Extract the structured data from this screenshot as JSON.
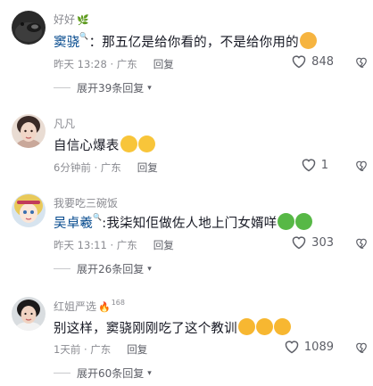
{
  "comments": [
    {
      "username": "好好",
      "badge": "🌿",
      "mention": "窦骁",
      "text": "：那五亿是给你看的，不是给你用的",
      "emoji": "🥴",
      "time": "昨天 13:28",
      "location": "广东",
      "reply": "回复",
      "likes": "848",
      "expand": "展开39条回复"
    },
    {
      "username": "凡凡",
      "text": "自信心爆表",
      "emoji": "😂😂",
      "time": "6分钟前",
      "location": "广东",
      "reply": "回复",
      "likes": "1"
    },
    {
      "username": "我要吃三碗饭",
      "mention": "吴卓羲",
      "text": ":我柒知佢做佐人地上门女婿咩",
      "emoji": "🤮🤮",
      "time": "昨天 13:11",
      "location": "广东",
      "reply": "回复",
      "likes": "303",
      "expand": "展开26条回复"
    },
    {
      "username": "红姐严选",
      "badge": "🔥",
      "level": "168",
      "text": "别这样，窦骁刚刚吃了这个教训",
      "emoji": "😍😍😍",
      "time": "1天前",
      "location": "广东",
      "reply": "回复",
      "likes": "1089",
      "expand": "展开60条回复"
    }
  ],
  "separator": " · ",
  "colors": {
    "text": "#161823",
    "meta": "#8a8b91",
    "mention": "#04498d",
    "background": "#ffffff"
  }
}
